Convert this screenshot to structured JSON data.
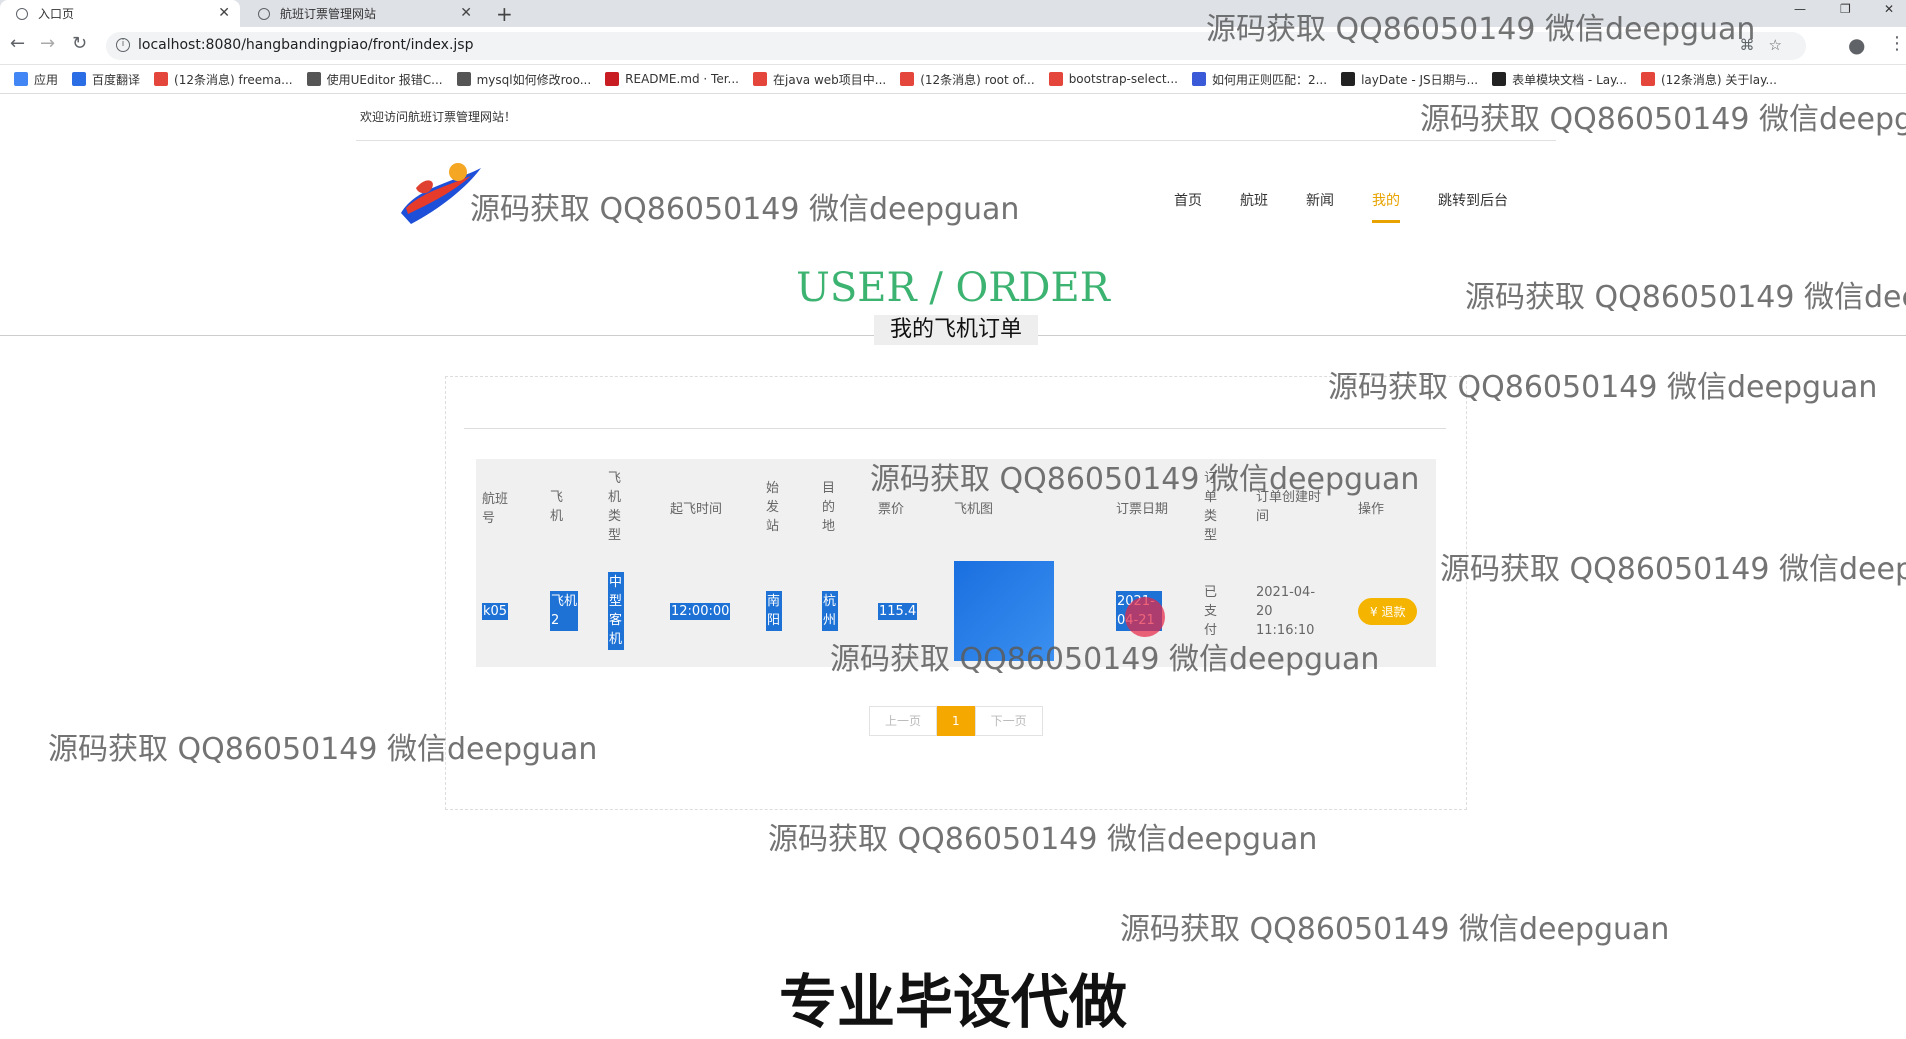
{
  "browser": {
    "tabs": [
      {
        "title": "入口页"
      },
      {
        "title": "航班订票管理网站"
      }
    ],
    "url": "localhost:8080/hangbandingpiao/front/index.jsp",
    "bookmarks": [
      {
        "label": "应用",
        "color": "#4285f4"
      },
      {
        "label": "百度翻译",
        "color": "#2b6de5"
      },
      {
        "label": "(12条消息) freema...",
        "color": "#e5463c"
      },
      {
        "label": "使用UEditor 报错C...",
        "color": "#555555"
      },
      {
        "label": "mysql如何修改roo...",
        "color": "#555555"
      },
      {
        "label": "README.md · Ter...",
        "color": "#c71d23"
      },
      {
        "label": "在java web项目中...",
        "color": "#e5463c"
      },
      {
        "label": "(12条消息) root of...",
        "color": "#e5463c"
      },
      {
        "label": "bootstrap-select...",
        "color": "#e5463c"
      },
      {
        "label": "如何用正则匹配：2...",
        "color": "#3a5ad8"
      },
      {
        "label": "layDate - JS日期与...",
        "color": "#222222"
      },
      {
        "label": "表单模块文档 - Lay...",
        "color": "#222222"
      },
      {
        "label": "(12条消息) 关于lay...",
        "color": "#e5463c"
      }
    ]
  },
  "header": {
    "welcome": "欢迎访问航班订票管理网站！",
    "nav": [
      {
        "label": "首页",
        "active": false
      },
      {
        "label": "航班",
        "active": false
      },
      {
        "label": "新闻",
        "active": false
      },
      {
        "label": "我的",
        "active": true
      },
      {
        "label": "跳转到后台",
        "active": false
      }
    ]
  },
  "section": {
    "title": "USER / ORDER",
    "subtitle": "我的飞机订单"
  },
  "table": {
    "headers": [
      "航班号",
      "飞机",
      "飞机类型",
      "起飞时间",
      "始发站",
      "目的地",
      "票价",
      "飞机图",
      "订票日期",
      "订单类型",
      "订单创建时间",
      "操作"
    ],
    "rows": [
      {
        "flight_no": "k05",
        "plane": "飞机2",
        "plane_type": "中型客机",
        "takeoff": "12:00:00",
        "origin": "南阳",
        "destination": "杭州",
        "price": "115.4",
        "booking_date": "2021-04-21",
        "order_type": "已支付",
        "created": "2021-04-20 11:16:10",
        "action": "退款"
      }
    ]
  },
  "pager": {
    "prev": "上一页",
    "current": "1",
    "next": "下一页"
  },
  "watermark": "源码获取 QQ86050149 微信deepguan",
  "banner": "专业毕设代做",
  "colors": {
    "accent": "#e8a300",
    "title_green": "#3cb371",
    "selection": "#1e72d6"
  }
}
